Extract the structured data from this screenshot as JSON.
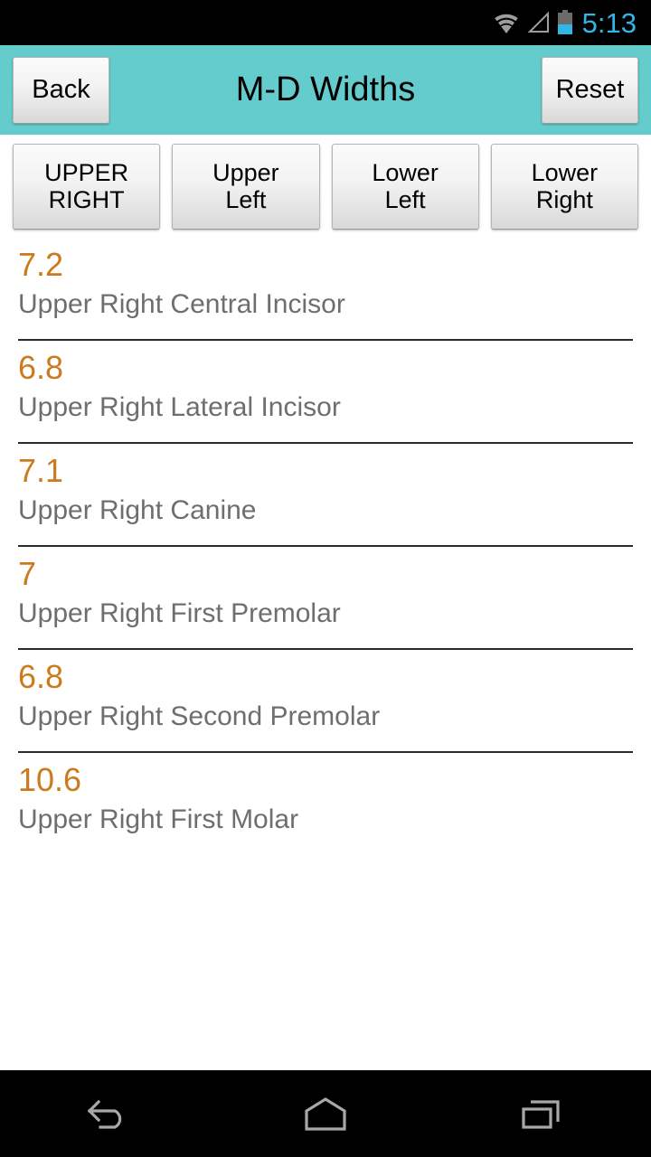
{
  "status_bar": {
    "time": "5:13",
    "time_color": "#33B5E5",
    "background": "#000000",
    "icons": [
      "wifi-icon",
      "cell-signal-icon",
      "battery-icon"
    ]
  },
  "action_bar": {
    "background": "#64CCCC",
    "title": "M-D Widths",
    "back_label": "Back",
    "reset_label": "Reset"
  },
  "quadrants": {
    "buttons": [
      {
        "label": "UPPER\nRIGHT",
        "name": "quadrant-upper-right",
        "selected": true
      },
      {
        "label": "Upper\nLeft",
        "name": "quadrant-upper-left",
        "selected": false
      },
      {
        "label": "Lower\nLeft",
        "name": "quadrant-lower-left",
        "selected": false
      },
      {
        "label": "Lower\nRight",
        "name": "quadrant-lower-right",
        "selected": false
      }
    ]
  },
  "list": {
    "value_color": "#CC7A1E",
    "label_color": "#6E6E6E",
    "items": [
      {
        "value": "7.2",
        "label": "Upper Right Central Incisor"
      },
      {
        "value": "6.8",
        "label": "Upper Right Lateral Incisor"
      },
      {
        "value": "7.1",
        "label": "Upper Right Canine"
      },
      {
        "value": "7",
        "label": "Upper Right First Premolar"
      },
      {
        "value": "6.8",
        "label": "Upper Right Second Premolar"
      },
      {
        "value": "10.6",
        "label": "Upper Right First Molar"
      }
    ]
  },
  "nav_bar": {
    "background": "#000000",
    "buttons": [
      "back-nav-icon",
      "home-nav-icon",
      "recents-nav-icon"
    ]
  }
}
